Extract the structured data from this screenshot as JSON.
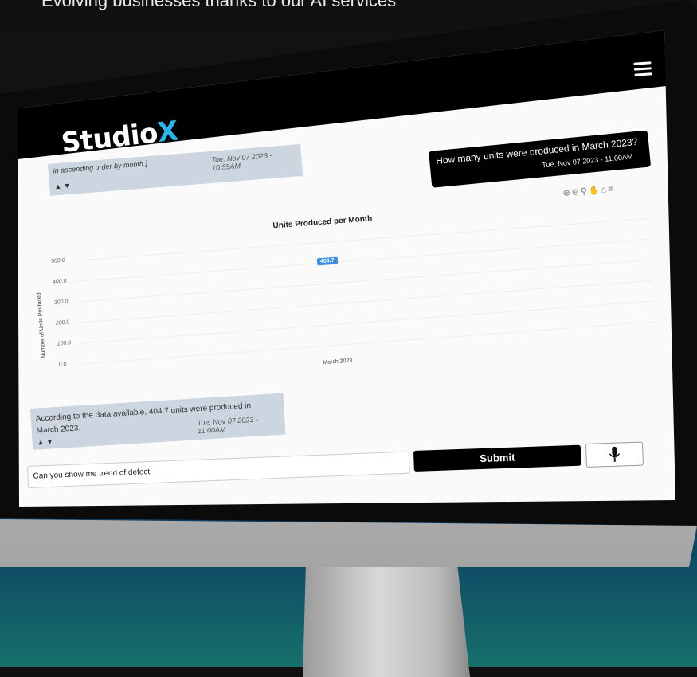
{
  "headline": "Evolving businesses thanks to our AI services",
  "app": {
    "logo_main": "Studio",
    "logo_accent": "X"
  },
  "chat": {
    "prev_bot": {
      "text": "in ascending order by month.]",
      "time": "Tue, Nov 07 2023 - 10:59AM"
    },
    "user": {
      "text": "How many units were produced in March 2023?",
      "time": "Tue, Nov 07 2023 - 11:00AM"
    },
    "bot": {
      "text": "According to the data available, 404.7 units were produced in March 2023.",
      "time": "Tue, Nov 07 2023 - 11:00AM"
    }
  },
  "chart_data": {
    "type": "bar",
    "title": "Units Produced per Month",
    "categories": [
      "March 2023"
    ],
    "values": [
      404.7
    ],
    "ylabel": "Number of Units Produced",
    "ylim": [
      0,
      500
    ],
    "yticks": [
      "500.0",
      "400.0",
      "300.0",
      "200.0",
      "100.0",
      "0.0"
    ],
    "data_labels": [
      "404.7"
    ],
    "grid": true
  },
  "toolbar": {
    "icons": [
      "zoom-in-icon",
      "zoom-out-icon",
      "magnify-icon",
      "pan-icon",
      "home-icon",
      "menu-icon"
    ]
  },
  "input": {
    "value": "Can you show me trend of defect"
  },
  "submit_label": "Submit",
  "colors": {
    "accent": "#27b7e8",
    "bar_label": "#3d8de0",
    "bot_bubble": "#cdd6e0"
  }
}
